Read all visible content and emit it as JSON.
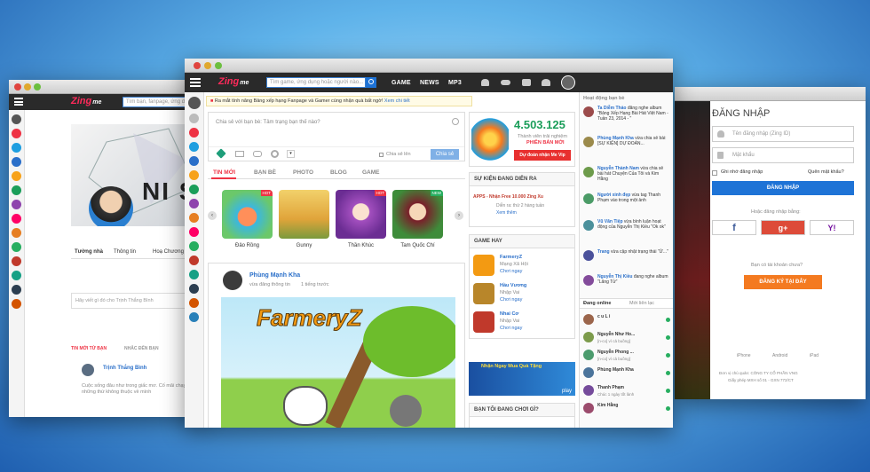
{
  "left_window": {
    "logo_z": "Zing",
    "logo_m": "me",
    "search_placeholder": "Tìm bạn, fanpage, ứng dụng",
    "profile_big_text": "NI S",
    "profile_name_tag": "Tường nhà",
    "tabs": [
      "Tường nhà",
      "Thông tin",
      "Hoạ Chương"
    ],
    "compose_placeholder": "Hãy viết gì đó cho Trịnh Thắng Bình",
    "feed_tabs": [
      "TIN MỚI TỪ BẠN",
      "NHẮC ĐẾN BẠN"
    ],
    "poster_name": "Trịnh Thắng Bình",
    "post_text": "Cuộc sống đâu như trong giấc mơ. Cố mãi chạy theo những thứ không thuộc về mình"
  },
  "main_window": {
    "logo_z": "Zing",
    "logo_m": "me",
    "search_placeholder": "Tìm game, ứng dụng hoặc người nào...",
    "nav_links": [
      "GAME",
      "NEWS",
      "MP3"
    ],
    "banner_text": "Ra mắt tính năng Bảng xếp hạng Fanpage và Gamer cùng nhận quà bất ngờ!",
    "banner_link": "Xem chi tiết",
    "compose_placeholder": "Chia sẻ với bạn bè: Tâm trạng bạn thế nào?",
    "compose_share": "Chia sẻ lên",
    "compose_button": "Chia sẻ",
    "feed_tabs": [
      "TIN MỚI",
      "BẠN BÈ",
      "PHOTO",
      "BLOG",
      "GAME"
    ],
    "games": [
      {
        "name": "Đảo Rồng",
        "badge": "HOT"
      },
      {
        "name": "Gunny",
        "badge": ""
      },
      {
        "name": "Thần Khúc",
        "badge": "HOT"
      },
      {
        "name": "Tam Quốc Chí",
        "badge": "NEW"
      }
    ],
    "post_author": "Phùng Mạnh Kha",
    "post_meta": "vừa đăng thông tin",
    "post_time": "1 tiếng trước",
    "post_image_title": "FarmeryZ",
    "promo_number": "4.503.125",
    "promo_line1": "Thành viên trải nghiệm",
    "promo_line2": "PHIÊN BẢN MỚI",
    "promo_button": "Dự đoán nhận Me Vip",
    "events_title": "SỰ KIỆN ĐANG DIỄN RA",
    "event_text": "APPS - Nhận Free 10.000 Zing Xu",
    "event_sub": "Diễn ra: thứ 2 hàng tuần",
    "event_link": "Xem thêm",
    "game_hay_title": "GAME HAY",
    "hot_games": [
      {
        "name": "FarmeryZ",
        "genre": "Mạng Xã Hội",
        "action": "Chơi ngay"
      },
      {
        "name": "Hầu Vương",
        "genre": "Nhập Vai",
        "action": "Chơi ngay"
      },
      {
        "name": "Nhai Cơ",
        "genre": "Nhập Vai",
        "action": "Chơi ngay"
      }
    ],
    "ad_text": "Nhận Ngay Mua Quà Tặng",
    "ad_sub": "play",
    "friends_playing_title": "BẠN TÔI ĐANG CHƠI GÌ?",
    "activity_title": "Hoạt động bạn bè",
    "activities": [
      {
        "name": "Ta Diễm Thảo",
        "text": "đăng nghe album \"Bảng Xếp Hạng Bài Hát Việt Nam - Tuần 23, 2014 - \""
      },
      {
        "name": "Phùng Mạnh Kha",
        "text": "vừa chia sẻ bài: [SỰ KIỆN] DỰ ĐOÁN..."
      },
      {
        "name": "Nguyễn Thành Nam",
        "text": "vừa chia sẻ bài hát Chuyện Của Tôi và Kim Hằng"
      },
      {
        "name": "Người xinh đẹp",
        "text": "vừa tag Thanh Phạm vào trong một ảnh"
      },
      {
        "name": "Vũ Văn Tiệp",
        "text": "vừa bình luận hoạt động của Nguyễn Thị Kiều \"Ok ok\""
      },
      {
        "name": "Trang",
        "text": "vừa cập nhật trạng thái \"Ừ...\""
      },
      {
        "name": "Nguyễn Thị Kiều",
        "text": "đang nghe album \"Lãng Tử\""
      }
    ],
    "online_tabs": [
      "Đang online",
      "Mới liên lạc"
    ],
    "online_friends": [
      "c u L i",
      "Nguyễn Như Ho...",
      "Nguyễn Phong ...",
      "Phùng Mạnh Kha",
      "Thanh Phạm",
      "Kim Hằng"
    ],
    "online_status": [
      "",
      "[n-co] vì cả buồng]",
      "[n-co] vì cả buồng]",
      "",
      "Chúc 1 ngày tốt lành",
      ""
    ]
  },
  "right_window": {
    "login_title": "ĐĂNG NHẬP",
    "username_placeholder": "Tên đăng nhập (Zing ID)",
    "password_placeholder": "Mật khẩu",
    "remember_label": "Ghi nhớ đăng nhập",
    "forgot_label": "Quên mật khẩu?",
    "login_button": "ĐĂNG NHẬP",
    "social_label": "Hoặc đăng nhập bằng:",
    "social_buttons": [
      "f",
      "g+",
      "Y!"
    ],
    "register_prompt": "Bạn có tài khoản chưa?",
    "register_button": "ĐĂNG KÝ TẠI ĐÂY",
    "platforms": [
      "iPhone",
      "Android",
      "iPad"
    ],
    "footer_line1": "Đơn vị chủ quản: CÔNG TY CỔ PHẦN VNG",
    "footer_line2": "Giấy phép MXH số 01 - GXN 772/CT"
  },
  "colors": {
    "accent_blue": "#1e73d6",
    "accent_orange": "#f47a20",
    "zing_pink": "#ff2a5a",
    "nav_dark": "#2a2a2a"
  }
}
